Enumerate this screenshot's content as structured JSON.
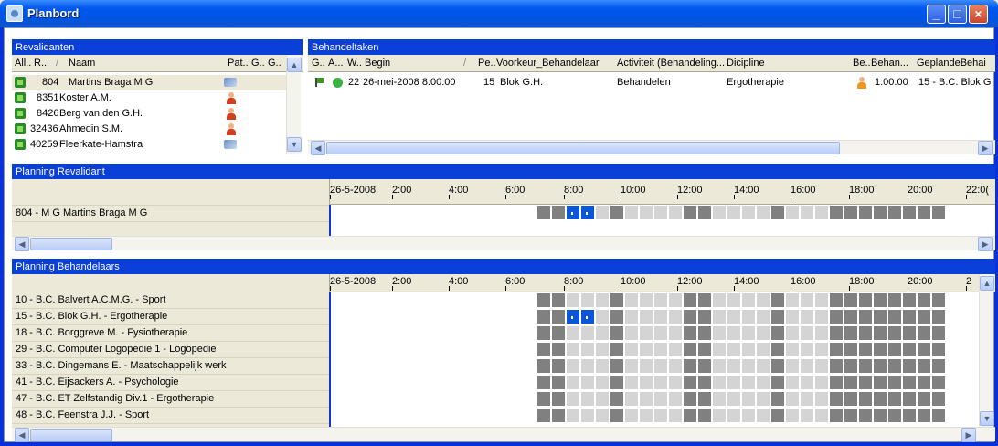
{
  "window": {
    "title": "Planbord"
  },
  "revalidanten": {
    "header": "Revalidanten",
    "columns": [
      "All..",
      "R...",
      "Naam",
      "Pat..",
      "G..",
      "G.."
    ],
    "rows": [
      {
        "nr": "804",
        "naam": "Martins Braga M G",
        "icon": "edit-icon"
      },
      {
        "nr": "8351",
        "naam": "Koster A.M.",
        "icon": "person-icon"
      },
      {
        "nr": "8426",
        "naam": "Berg van den G.H.",
        "icon": "person-icon"
      },
      {
        "nr": "32436",
        "naam": "Ahmedin S.M.",
        "icon": "person-icon"
      },
      {
        "nr": "40259",
        "naam": "Fleerkate-Hamstra",
        "icon": "edit-icon"
      }
    ]
  },
  "behandeltaken": {
    "header": "Behandeltaken",
    "columns": [
      "G..",
      "A...",
      "W..",
      "Begin",
      "Pe..",
      "Voorkeur_Behandelaar",
      "Activiteit (Behandeling...",
      "Dicipline",
      "Be..",
      "Behan...",
      "GeplandeBehai"
    ],
    "rows": [
      {
        "w": "22",
        "begin": "26-mei-2008 8:00:00",
        "pe": "15",
        "voorkeur": "Blok G.H.",
        "activiteit": "Behandelen",
        "dicipline": "Ergotherapie",
        "behan": "1:00:00",
        "gepland": "15 - B.C. Blok G"
      }
    ]
  },
  "planning_revalidant": {
    "header": "Planning Revalidant",
    "date": "26-5-2008",
    "times": [
      "2:00",
      "4:00",
      "6:00",
      "8:00",
      "10:00",
      "12:00",
      "14:00",
      "16:00",
      "18:00",
      "20:00",
      "22:0("
    ],
    "rows": [
      "804 - M G  Martins Braga M G"
    ]
  },
  "planning_behandelaars": {
    "header": "Planning Behandelaars",
    "date": "26-5-2008",
    "times": [
      "2:00",
      "4:00",
      "6:00",
      "8:00",
      "10:00",
      "12:00",
      "14:00",
      "16:00",
      "18:00",
      "20:00",
      "2"
    ],
    "rows": [
      "10 - B.C. Balvert A.C.M.G. - Sport",
      "15 - B.C. Blok G.H. - Ergotherapie",
      "18 - B.C. Borggreve M. - Fysiotherapie",
      "29 - B.C. Computer Logopedie 1 - Logopedie",
      "33 - B.C. Dingemans E. - Maatschappelijk werk",
      "41 - B.C. Eijsackers A. - Psychologie",
      "47 - B.C. ET Zelfstandig Div.1 - Ergotherapie",
      "48 - B.C. Feenstra J.J. - Sport"
    ]
  }
}
